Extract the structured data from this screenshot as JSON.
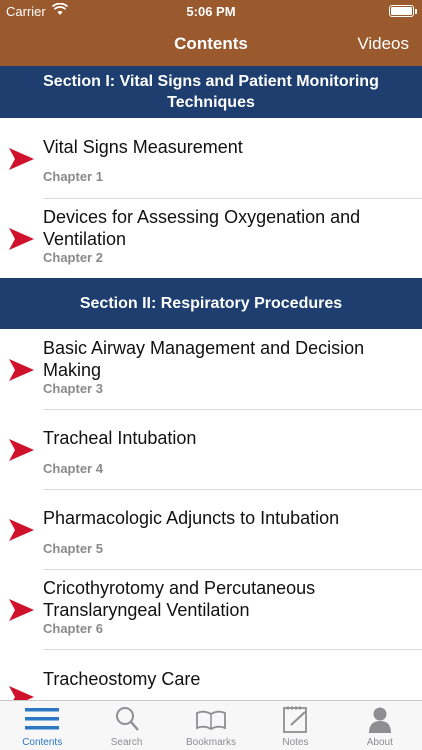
{
  "status": {
    "carrier": "Carrier",
    "time": "5:06 PM"
  },
  "nav": {
    "title": "Contents",
    "right_button": "Videos"
  },
  "sections": [
    {
      "title": "Section I: Vital Signs and Patient Monitoring Techniques",
      "chapters": [
        {
          "title": "Vital Signs Measurement",
          "chapter": "Chapter 1"
        },
        {
          "title": "Devices for Assessing Oxygenation and Ventilation",
          "chapter": "Chapter 2"
        }
      ]
    },
    {
      "title": "Section II: Respiratory Procedures",
      "chapters": [
        {
          "title": "Basic Airway Management and Decision Making",
          "chapter": "Chapter 3"
        },
        {
          "title": "Tracheal Intubation",
          "chapter": "Chapter 4"
        },
        {
          "title": "Pharmacologic Adjuncts to Intubation",
          "chapter": "Chapter 5"
        },
        {
          "title": "Cricothyrotomy and Percutaneous Translaryngeal Ventilation",
          "chapter": "Chapter 6"
        },
        {
          "title": "Tracheostomy Care",
          "chapter": ""
        }
      ]
    }
  ],
  "tabs": [
    {
      "label": "Contents",
      "icon": "list-icon",
      "active": true
    },
    {
      "label": "Search",
      "icon": "search-icon",
      "active": false
    },
    {
      "label": "Bookmarks",
      "icon": "book-icon",
      "active": false
    },
    {
      "label": "Notes",
      "icon": "notepad-icon",
      "active": false
    },
    {
      "label": "About",
      "icon": "person-icon",
      "active": false
    }
  ],
  "colors": {
    "nav_bar": "#9a5a2e",
    "section_header": "#1d3e6e",
    "arrow": "#d0112b",
    "tab_active": "#2b78c5"
  }
}
